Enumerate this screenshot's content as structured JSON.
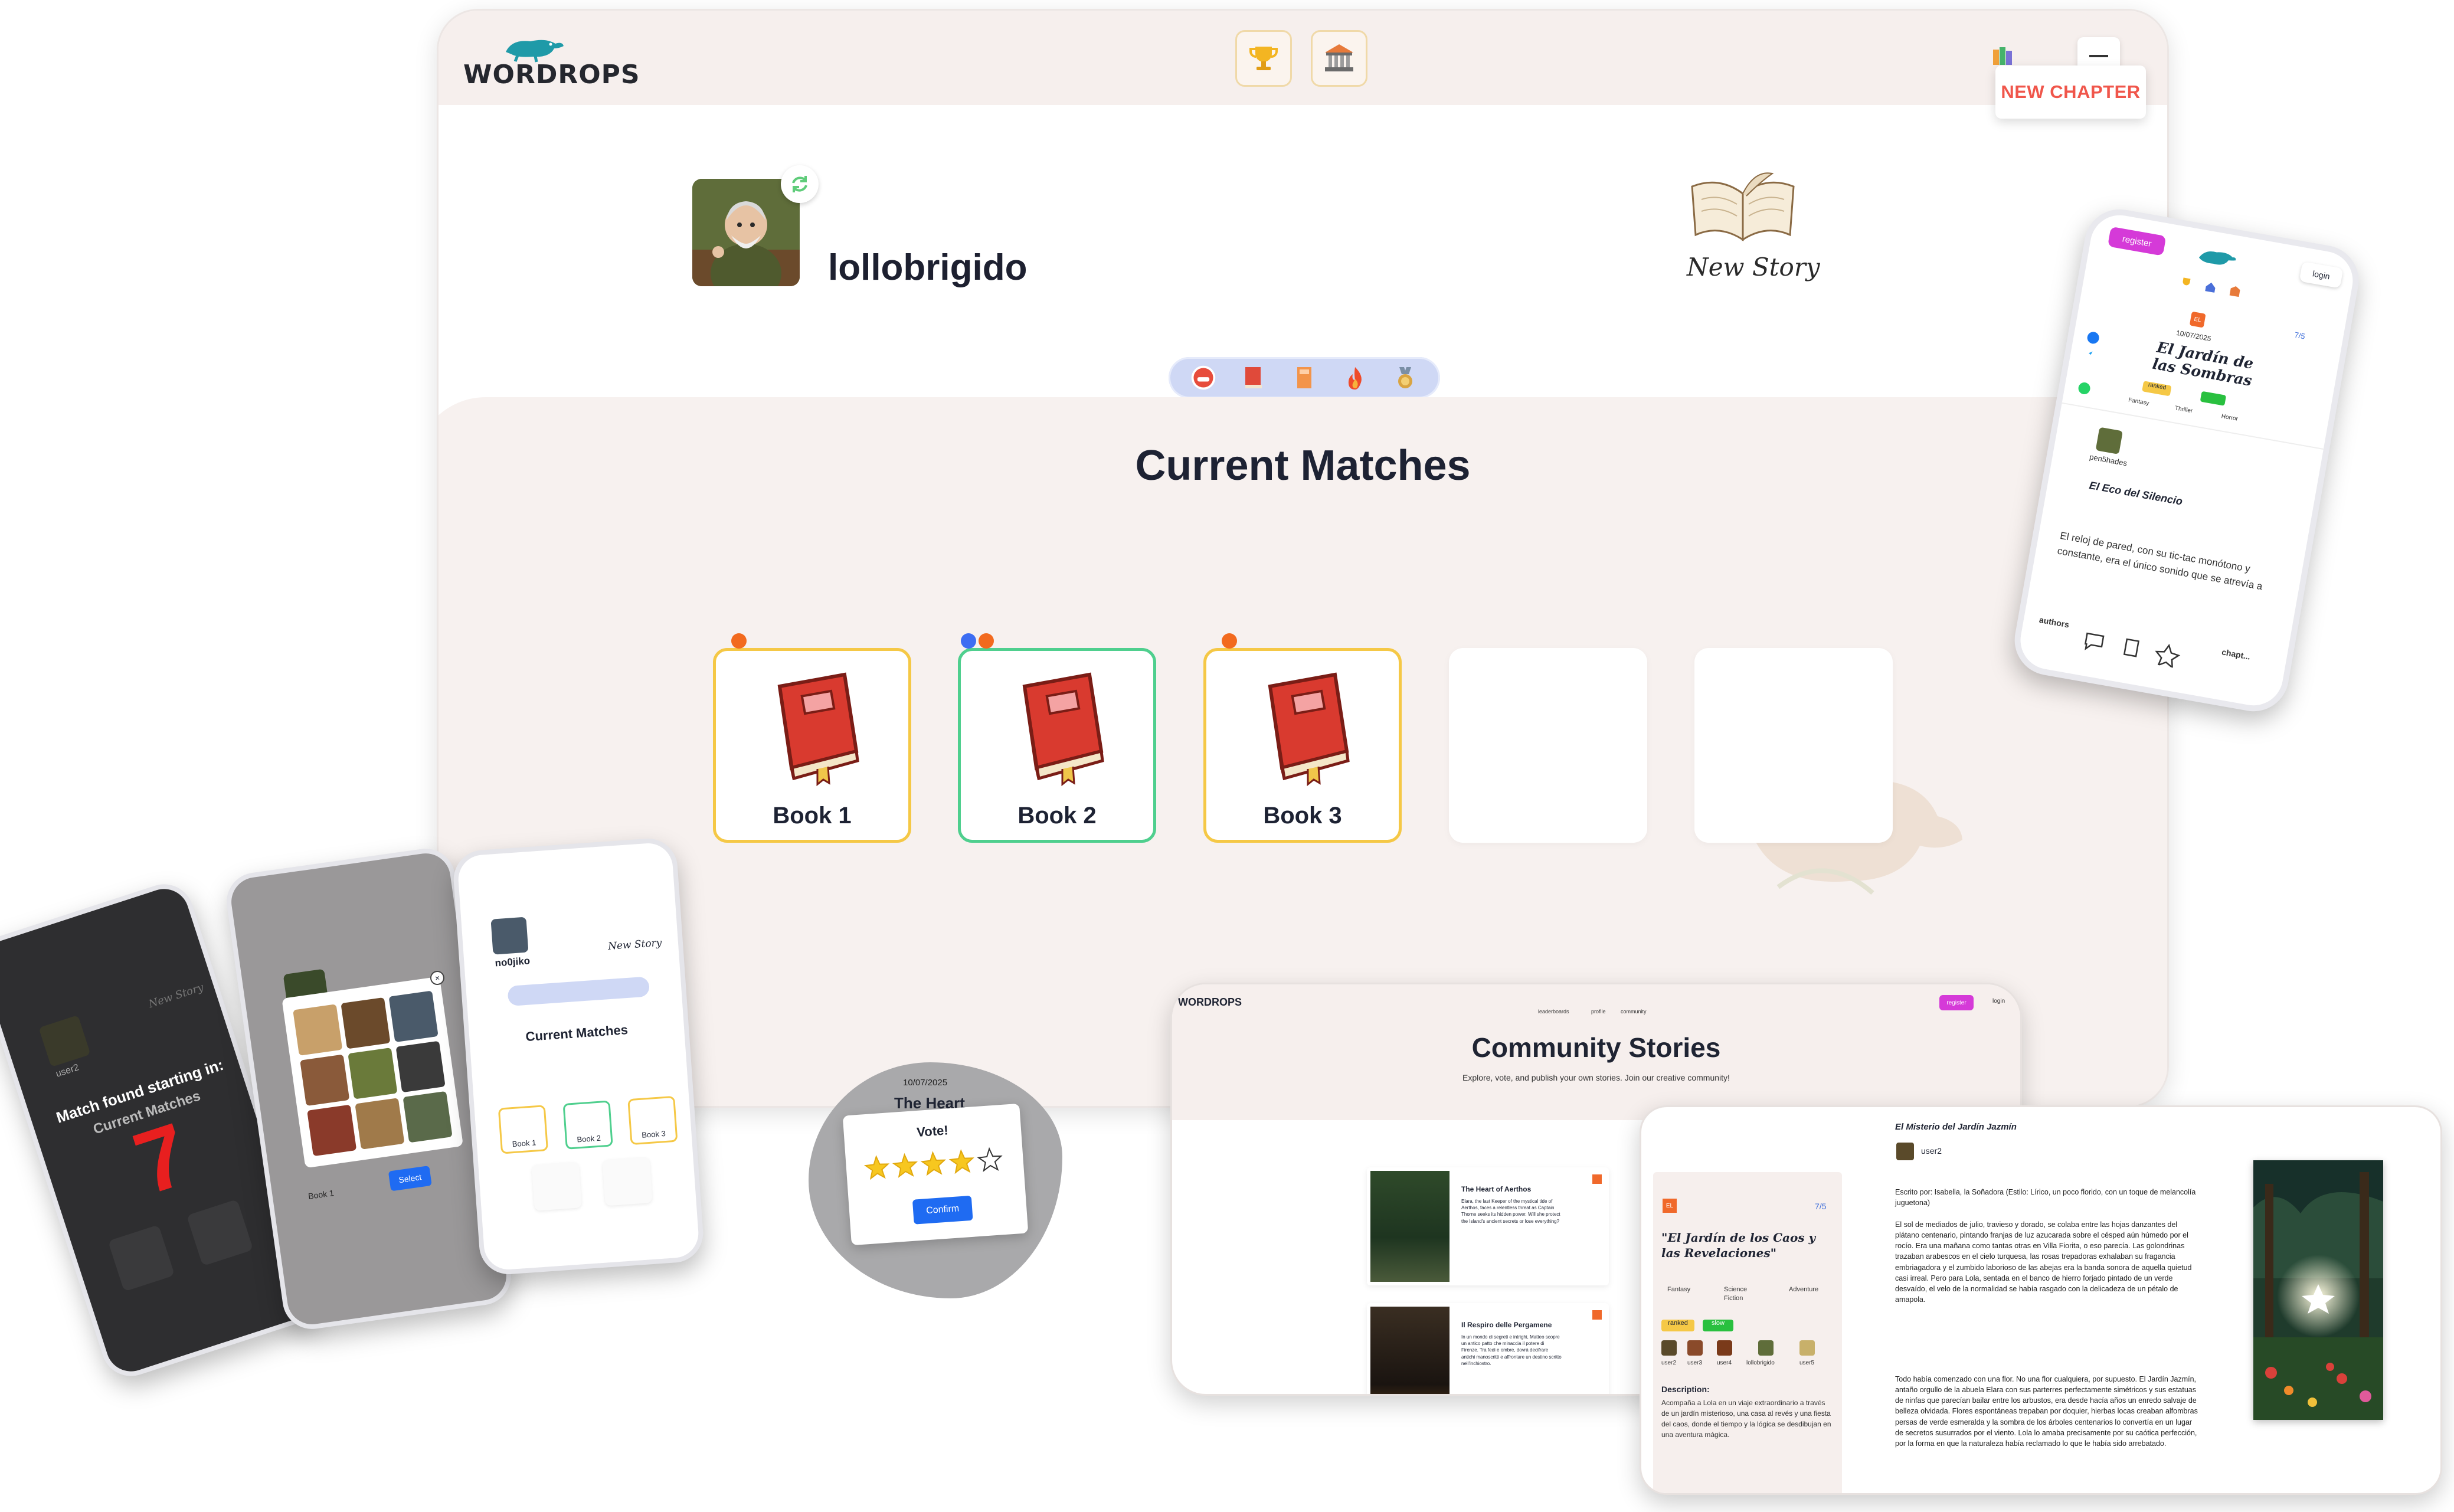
{
  "main": {
    "logo": "WORDROPS",
    "new_chapter": "NEW CHAPTER",
    "username": "lollobrigido",
    "new_story": "New Story",
    "matches_title": "Current Matches",
    "books": [
      "Book 1",
      "Book 2",
      "Book 3"
    ]
  },
  "phone_right": {
    "register": "register",
    "login": "login",
    "date": "10/07/2025",
    "badge": "EL",
    "rating": "7/5",
    "title": "El Jardín de las Sombras",
    "tag_ranked": "ranked",
    "tag_green": "",
    "genres": [
      "Fantasy",
      "Thriller",
      "Horror"
    ],
    "author": "pen5hades",
    "chapter_title": "El Eco del Silencio",
    "excerpt": "El reloj de pared, con su tic-tac monótono y constante, era el único sonido que se atrevía a",
    "footer_authors": "authors",
    "footer_chapters": "chapt..."
  },
  "phone_left1": {
    "user": "user2",
    "new_story": "New Story",
    "match_found": "Match found starting in:",
    "current_matches": "Current Matches",
    "countdown": "7"
  },
  "phone_left2": {
    "select": "Select",
    "book": "Book 1"
  },
  "phone_left3": {
    "username": "no0jiko",
    "new_story": "New Story",
    "matches_title": "Current Matches",
    "books": [
      "Book 1",
      "Book 2",
      "Book 3"
    ]
  },
  "vote_popup": {
    "date": "10/07/2025",
    "title": "The Heart",
    "vote": "Vote!",
    "confirm": "Confirm",
    "stars_filled": 4,
    "stars_total": 5
  },
  "community": {
    "nav": [
      "leaderboards",
      "profile",
      "community"
    ],
    "register": "register",
    "login": "login",
    "title": "Community Stories",
    "subtitle": "Explore, vote, and publish your own stories. Join our creative community!",
    "stories": [
      {
        "title": "The Heart of Aerthos",
        "body": "Elara, the last Keeper of the mystical tide of Aerthos, faces a relentless threat as Captain Thorne seeks its hidden power. Will she protect the Island's ancient secrets or lose everything?"
      },
      {
        "title": "Il Respiro delle Pergamene",
        "body": "In un mondo di segreti e intrighi, Matteo scopre un antico patto che minaccia il potere di Firenze. Tra fedi e ombre, dovrà decifrare antichi manoscritti e affrontare un destino scritto nell'inchiostro."
      }
    ]
  },
  "detail": {
    "badge": "EL",
    "rating": "7/5",
    "title": "\"El Jardín de los Caos y las Revelaciones\"",
    "genres": [
      "Fantasy",
      "Science Fiction",
      "Adventure"
    ],
    "tag_ranked": "ranked",
    "tag_green": "slow",
    "users": [
      "user2",
      "user3",
      "user4",
      "lollobrigido",
      "user5"
    ],
    "description_label": "Description:",
    "description": "Acompaña a Lola en un viaje extraordinario a través de un jardín misterioso, una casa al revés y una fiesta del caos, donde el tiempo y la lógica se desdibujan en una aventura mágica.",
    "chapter_title": "El Misterio del Jardín Jazmín",
    "chapter_author": "user2",
    "written_by": "Escrito por: Isabella, la Soñadora (Estilo: Lírico, un poco florido, con un toque de melancolía juguetona)",
    "para1": "El sol de mediados de julio, travieso y dorado, se colaba entre las hojas danzantes del plátano centenario, pintando franjas de luz azucarada sobre el césped aún húmedo por el rocío. Era una mañana como tantas otras en Villa Fiorita, o eso parecía. Las golondrinas trazaban arabescos en el cielo turquesa, las rosas trepadoras exhalaban su fragancia embriagadora y el zumbido laborioso de las abejas era la banda sonora de aquella quietud casi irreal. Pero para Lola, sentada en el banco de hierro forjado pintado de un verde desvaído, el velo de la normalidad se había rasgado con la delicadeza de un pétalo de amapola.",
    "para2": "Todo había comenzado con una flor. No una flor cualquiera, por supuesto. El Jardín Jazmín, antaño orgullo de la abuela Elara con sus parterres perfectamente simétricos y sus estatuas de ninfas que parecían bailar entre los arbustos, era desde hacía años un enredo salvaje de belleza olvidada. Flores espontáneas trepaban por doquier, hierbas locas creaban alfombras persas de verde esmeralda y la sombra de los árboles centenarios lo convertía en un lugar de secretos susurrados por el viento. Lola lo amaba precisamente por su caótica perfección, por la forma en que la naturaleza había reclamado lo que le había sido arrebatado."
  },
  "colors": {
    "accent_red": "#f0564b",
    "book_yellow": "#f5c846",
    "book_green": "#4fcf8e",
    "teal_logo": "#1f9aa8",
    "primary_blue": "#1f6bf2",
    "register_pink": "#d53ad8"
  }
}
